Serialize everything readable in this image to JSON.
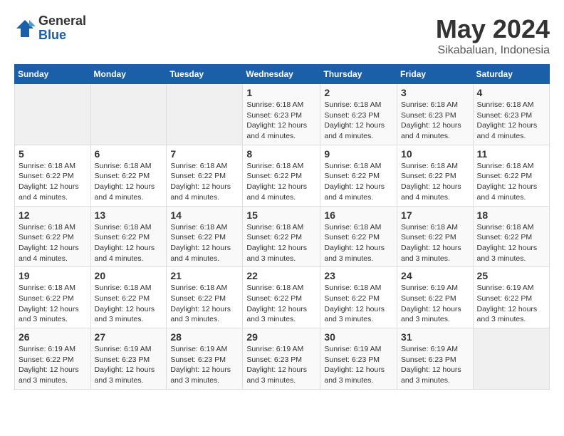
{
  "logo": {
    "general": "General",
    "blue": "Blue"
  },
  "title": {
    "month_year": "May 2024",
    "location": "Sikabaluan, Indonesia"
  },
  "weekdays": [
    "Sunday",
    "Monday",
    "Tuesday",
    "Wednesday",
    "Thursday",
    "Friday",
    "Saturday"
  ],
  "weeks": [
    [
      {
        "day": "",
        "info": ""
      },
      {
        "day": "",
        "info": ""
      },
      {
        "day": "",
        "info": ""
      },
      {
        "day": "1",
        "info": "Sunrise: 6:18 AM\nSunset: 6:23 PM\nDaylight: 12 hours\nand 4 minutes."
      },
      {
        "day": "2",
        "info": "Sunrise: 6:18 AM\nSunset: 6:23 PM\nDaylight: 12 hours\nand 4 minutes."
      },
      {
        "day": "3",
        "info": "Sunrise: 6:18 AM\nSunset: 6:23 PM\nDaylight: 12 hours\nand 4 minutes."
      },
      {
        "day": "4",
        "info": "Sunrise: 6:18 AM\nSunset: 6:23 PM\nDaylight: 12 hours\nand 4 minutes."
      }
    ],
    [
      {
        "day": "5",
        "info": "Sunrise: 6:18 AM\nSunset: 6:22 PM\nDaylight: 12 hours\nand 4 minutes."
      },
      {
        "day": "6",
        "info": "Sunrise: 6:18 AM\nSunset: 6:22 PM\nDaylight: 12 hours\nand 4 minutes."
      },
      {
        "day": "7",
        "info": "Sunrise: 6:18 AM\nSunset: 6:22 PM\nDaylight: 12 hours\nand 4 minutes."
      },
      {
        "day": "8",
        "info": "Sunrise: 6:18 AM\nSunset: 6:22 PM\nDaylight: 12 hours\nand 4 minutes."
      },
      {
        "day": "9",
        "info": "Sunrise: 6:18 AM\nSunset: 6:22 PM\nDaylight: 12 hours\nand 4 minutes."
      },
      {
        "day": "10",
        "info": "Sunrise: 6:18 AM\nSunset: 6:22 PM\nDaylight: 12 hours\nand 4 minutes."
      },
      {
        "day": "11",
        "info": "Sunrise: 6:18 AM\nSunset: 6:22 PM\nDaylight: 12 hours\nand 4 minutes."
      }
    ],
    [
      {
        "day": "12",
        "info": "Sunrise: 6:18 AM\nSunset: 6:22 PM\nDaylight: 12 hours\nand 4 minutes."
      },
      {
        "day": "13",
        "info": "Sunrise: 6:18 AM\nSunset: 6:22 PM\nDaylight: 12 hours\nand 4 minutes."
      },
      {
        "day": "14",
        "info": "Sunrise: 6:18 AM\nSunset: 6:22 PM\nDaylight: 12 hours\nand 4 minutes."
      },
      {
        "day": "15",
        "info": "Sunrise: 6:18 AM\nSunset: 6:22 PM\nDaylight: 12 hours\nand 3 minutes."
      },
      {
        "day": "16",
        "info": "Sunrise: 6:18 AM\nSunset: 6:22 PM\nDaylight: 12 hours\nand 3 minutes."
      },
      {
        "day": "17",
        "info": "Sunrise: 6:18 AM\nSunset: 6:22 PM\nDaylight: 12 hours\nand 3 minutes."
      },
      {
        "day": "18",
        "info": "Sunrise: 6:18 AM\nSunset: 6:22 PM\nDaylight: 12 hours\nand 3 minutes."
      }
    ],
    [
      {
        "day": "19",
        "info": "Sunrise: 6:18 AM\nSunset: 6:22 PM\nDaylight: 12 hours\nand 3 minutes."
      },
      {
        "day": "20",
        "info": "Sunrise: 6:18 AM\nSunset: 6:22 PM\nDaylight: 12 hours\nand 3 minutes."
      },
      {
        "day": "21",
        "info": "Sunrise: 6:18 AM\nSunset: 6:22 PM\nDaylight: 12 hours\nand 3 minutes."
      },
      {
        "day": "22",
        "info": "Sunrise: 6:18 AM\nSunset: 6:22 PM\nDaylight: 12 hours\nand 3 minutes."
      },
      {
        "day": "23",
        "info": "Sunrise: 6:18 AM\nSunset: 6:22 PM\nDaylight: 12 hours\nand 3 minutes."
      },
      {
        "day": "24",
        "info": "Sunrise: 6:19 AM\nSunset: 6:22 PM\nDaylight: 12 hours\nand 3 minutes."
      },
      {
        "day": "25",
        "info": "Sunrise: 6:19 AM\nSunset: 6:22 PM\nDaylight: 12 hours\nand 3 minutes."
      }
    ],
    [
      {
        "day": "26",
        "info": "Sunrise: 6:19 AM\nSunset: 6:22 PM\nDaylight: 12 hours\nand 3 minutes."
      },
      {
        "day": "27",
        "info": "Sunrise: 6:19 AM\nSunset: 6:23 PM\nDaylight: 12 hours\nand 3 minutes."
      },
      {
        "day": "28",
        "info": "Sunrise: 6:19 AM\nSunset: 6:23 PM\nDaylight: 12 hours\nand 3 minutes."
      },
      {
        "day": "29",
        "info": "Sunrise: 6:19 AM\nSunset: 6:23 PM\nDaylight: 12 hours\nand 3 minutes."
      },
      {
        "day": "30",
        "info": "Sunrise: 6:19 AM\nSunset: 6:23 PM\nDaylight: 12 hours\nand 3 minutes."
      },
      {
        "day": "31",
        "info": "Sunrise: 6:19 AM\nSunset: 6:23 PM\nDaylight: 12 hours\nand 3 minutes."
      },
      {
        "day": "",
        "info": ""
      }
    ]
  ]
}
